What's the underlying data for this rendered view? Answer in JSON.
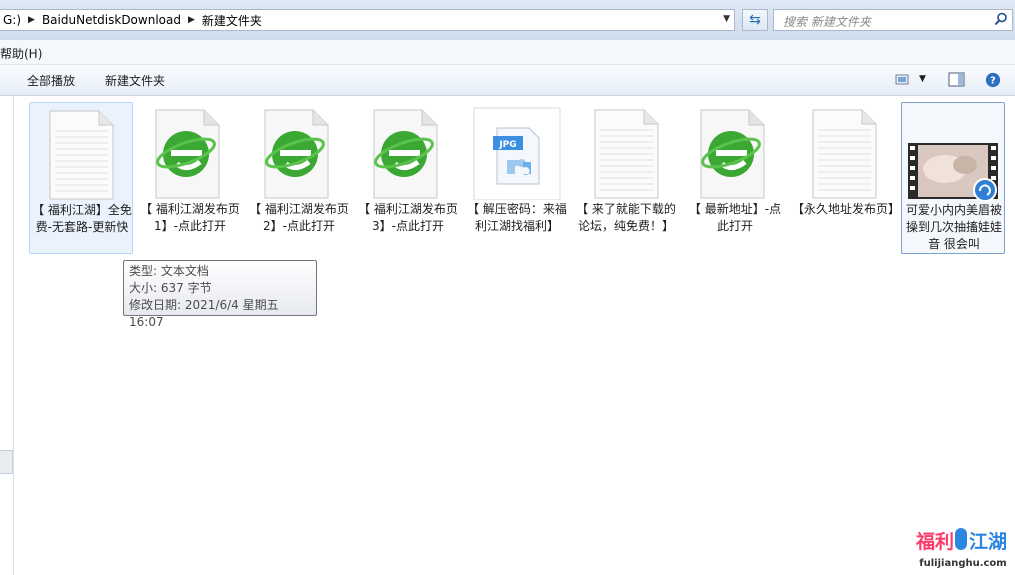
{
  "address": {
    "crumbs": [
      "G:)",
      "BaiduNetdiskDownload",
      "新建文件夹"
    ]
  },
  "search": {
    "placeholder": "搜索 新建文件夹"
  },
  "menu": {
    "help": "帮助(H)"
  },
  "toolbar": {
    "play_all": "全部播放",
    "new_folder": "新建文件夹"
  },
  "files": [
    {
      "name": "【 福利江湖】全免费-无套路-更新快",
      "icon": "text-doc"
    },
    {
      "name": "【 福利江湖发布页1】-点此打开",
      "icon": "ie-shortcut"
    },
    {
      "name": "【 福利江湖发布页2】-点此打开",
      "icon": "ie-shortcut"
    },
    {
      "name": "【 福利江湖发布页3】-点此打开",
      "icon": "ie-shortcut"
    },
    {
      "name": "【 解压密码：来福利江湖找福利】",
      "icon": "jpg-file"
    },
    {
      "name": "【 来了就能下载的论坛，纯免费！】",
      "icon": "text-doc"
    },
    {
      "name": "【 最新地址】-点此打开",
      "icon": "ie-shortcut"
    },
    {
      "name": "【永久地址发布页】",
      "icon": "text-doc"
    },
    {
      "name": "可爱小内内美眉被操到几次抽搐娃娃音 很会叫",
      "icon": "video-thumbnail"
    }
  ],
  "tooltip": {
    "type": "类型: 文本文档",
    "size": "大小: 637 字节",
    "modified": "修改日期: 2021/6/4 星期五 16:07"
  },
  "watermark": {
    "brand": "福利江湖",
    "url": "fulijianghu.com"
  }
}
